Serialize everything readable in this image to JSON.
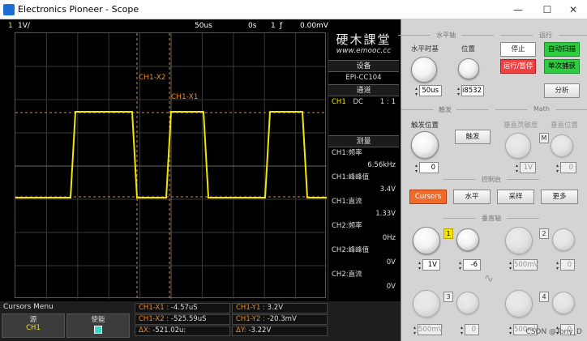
{
  "window": {
    "title": "Electronics Pioneer - Scope",
    "minimize": "—",
    "maximize": "☐",
    "close": "✕"
  },
  "scope_top": {
    "ch": "1",
    "volts": "1V/",
    "timebase": "50us",
    "offset": "0s",
    "trig_ch": "1",
    "trig_icon": "ƒ",
    "trig_level": "0.00mV"
  },
  "cursors": {
    "x2_label": "CH1-X2",
    "x1_label": "CH1-X1"
  },
  "waveform": {
    "type": "square",
    "levels": [
      0,
      3.4
    ],
    "period_div": 3,
    "note_units": "div"
  },
  "logo": {
    "cn": "硬木課堂",
    "url": "www.emooc.cc"
  },
  "meas_panel": {
    "device_header": "设备",
    "device": "EPI-CC104",
    "channel_header": "通道",
    "channel_row": {
      "ch": "CH1",
      "coupling": "DC",
      "ratio": "1 : 1"
    },
    "measure_header": "测量",
    "items": [
      {
        "label": "CH1:频率",
        "value": "6.56kHz"
      },
      {
        "label": "CH1:峰峰值",
        "value": "3.4V"
      },
      {
        "label": "CH1:直流",
        "value": "1.33V"
      },
      {
        "label": "CH2:频率",
        "value": "0Hz"
      },
      {
        "label": "CH2:峰峰值",
        "value": "0V"
      },
      {
        "label": "CH2:直流",
        "value": "0V"
      }
    ]
  },
  "cursor_menu": {
    "title": "Cursors Menu",
    "source_label": "源",
    "source_value": "CH1",
    "enable_label": "使能"
  },
  "cursor_readouts": {
    "x1": {
      "label": "CH1-X1 :",
      "value": "-4.57uS"
    },
    "x2": {
      "label": "CH1-X2 :",
      "value": "-525.59uS"
    },
    "dx": {
      "label": "ΔX:",
      "value": "-521.02u:"
    },
    "y1": {
      "label": "CH1-Y1 :",
      "value": "3.2V"
    },
    "y2": {
      "label": "CH1-Y2 :",
      "value": "-20.3mV"
    },
    "dy": {
      "label": "ΔY:",
      "value": "-3.22V"
    }
  },
  "panel": {
    "horizontal_section": "水平轴",
    "timebase_label": "水平时基",
    "timebase_value": "50us",
    "position_label": "位置",
    "position_value": "i8532",
    "run_section": "运行",
    "stop": "停止",
    "auto_scale": "自动扫描",
    "run_stop": "运行/暂停",
    "single": "单次捕获",
    "analyze": "分析",
    "trigger_section": "触发",
    "trig_pos_label": "触发位置",
    "trig_pos_value": "0",
    "trigger_btn": "触发",
    "math_section": "Math",
    "vscale_label": "垂直灵敏度",
    "vpos_label": "垂直位置",
    "math_m": "M",
    "math_scale_value": "1V",
    "math_pos_value": "0",
    "control_section": "控制台",
    "cursors_btn": "Cursors",
    "horizontal_btn": "水平",
    "acquire_btn": "采样",
    "more_btn": "更多",
    "vertical_section": "垂直轴",
    "ch1": "1",
    "ch2": "2",
    "ch3": "3",
    "ch4": "4",
    "ch1_scale": "1V",
    "ch1_pos": "-6",
    "ch2_scale": "500mV",
    "ch2_pos": "0",
    "ch3_scale": "500mV",
    "ch3_pos": "0",
    "ch4_scale": "500mV",
    "ch4_pos": "0"
  },
  "watermark": "CSDN @Tony_D",
  "colors": {
    "trace": "#f5e600",
    "cursor": "#e78b2a",
    "accent_orange": "#f06a2a",
    "green": "#2ecc40"
  }
}
